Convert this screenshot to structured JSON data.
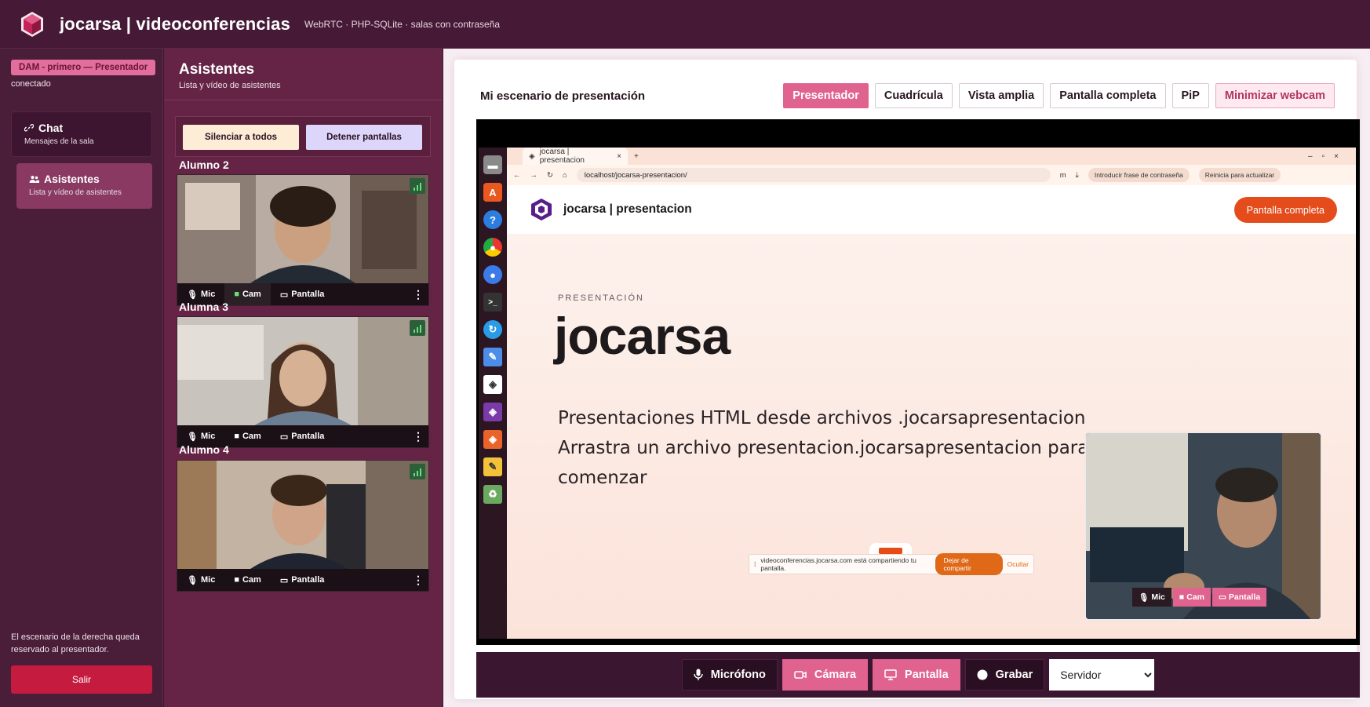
{
  "header": {
    "title": "jocarsa | videoconferencias",
    "subtitle": "WebRTC · PHP-SQLite · salas con contraseña"
  },
  "sidebar": {
    "session_badge": "DAM - primero — Presentador",
    "status": "conectado",
    "items": [
      {
        "label": "Chat",
        "desc": "Mensajes de la sala"
      },
      {
        "label": "Asistentes",
        "desc": "Lista y vídeo de asistentes"
      }
    ],
    "note": "El escenario de la derecha queda reservado al presentador.",
    "exit_label": "Salir"
  },
  "attendees": {
    "title": "Asistentes",
    "subtitle": "Lista y vídeo de asistentes",
    "silence_all": "Silenciar a todos",
    "stop_screens": "Detener pantallas",
    "tiles": [
      {
        "name": "Alumno 2",
        "mic": "Mic",
        "cam": "Cam",
        "screen": "Pantalla"
      },
      {
        "name": "Alumna 3",
        "mic": "Mic",
        "cam": "Cam",
        "screen": "Pantalla"
      },
      {
        "name": "Alumno 4",
        "mic": "Mic",
        "cam": "Cam",
        "screen": "Pantalla"
      }
    ]
  },
  "stage": {
    "title": "Mi escenario de presentación",
    "view_buttons": [
      "Presentador",
      "Cuadrícula",
      "Vista amplia",
      "Pantalla completa",
      "PiP",
      "Minimizar webcam"
    ],
    "browser": {
      "tab_title": "jocarsa | presentacion",
      "url": "localhost/jocarsa-presentacion/",
      "chip_1": "Introducir frase de contraseña",
      "chip_2": "Reinicia para actualizar"
    },
    "site": {
      "name": "jocarsa | presentacion",
      "fullscreen_btn": "Pantalla completa",
      "kicker": "PRESENTACIÓN",
      "hero_title": "jocarsa",
      "line_1": "Presentaciones HTML desde archivos .jocarsapresentacion",
      "line_2": "Arrastra un archivo presentacion.jocarsapresentacion para",
      "line_3": "comenzar"
    },
    "share_bar": {
      "text": "videoconferencias.jocarsa.com está compartiendo tu pantalla.",
      "stop": "Dejar de compartir",
      "hide": "Ocultar"
    },
    "pip_controls": {
      "mic": "Mic",
      "cam": "Cam",
      "screen": "Pantalla"
    }
  },
  "controls": {
    "mic": "Micrófono",
    "camera": "Cámara",
    "screen": "Pantalla",
    "record": "Grabar",
    "server_selected": "Servidor"
  },
  "colors": {
    "accent_pink": "#e0628f",
    "danger": "#c51b3e",
    "site_orange": "#e44c1b"
  }
}
